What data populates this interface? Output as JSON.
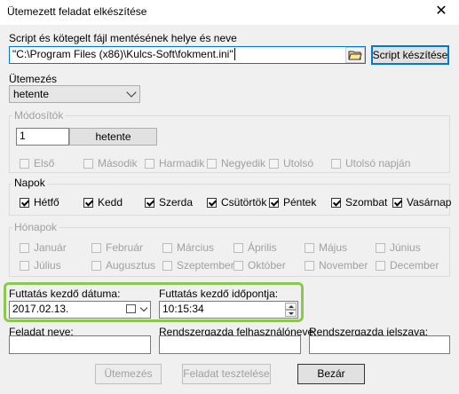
{
  "window": {
    "title": "Ütemezett feladat elkészítése",
    "close_symbol": "✕"
  },
  "script": {
    "label": "Script és kötegelt fájl mentésének helye és neve",
    "path_value": "\"C:\\Program Files (x86)\\Kulcs-Soft\\fokment.ini\"",
    "button": "Script készítése"
  },
  "schedule": {
    "label": "Ütemezés",
    "selected": "hetente"
  },
  "modifiers": {
    "group_title": "Módosítók",
    "number_value": "1",
    "number_button": "hetente",
    "options": [
      {
        "label": "Első",
        "checked": false
      },
      {
        "label": "Második",
        "checked": false
      },
      {
        "label": "Harmadik",
        "checked": false
      },
      {
        "label": "Negyedik",
        "checked": false
      },
      {
        "label": "Utolsó",
        "checked": false
      },
      {
        "label": "Utolsó napján",
        "checked": false
      }
    ]
  },
  "days": {
    "group_title": "Napok",
    "items": [
      {
        "label": "Hétfő",
        "checked": true
      },
      {
        "label": "Kedd",
        "checked": true
      },
      {
        "label": "Szerda",
        "checked": true
      },
      {
        "label": "Csütörtök",
        "checked": true
      },
      {
        "label": "Péntek",
        "checked": true
      },
      {
        "label": "Szombat",
        "checked": true
      },
      {
        "label": "Vasárnap",
        "checked": true
      }
    ]
  },
  "months": {
    "group_title": "Hónapok",
    "items": [
      {
        "label": "Január",
        "checked": false
      },
      {
        "label": "Február",
        "checked": false
      },
      {
        "label": "Március",
        "checked": false
      },
      {
        "label": "Április",
        "checked": false
      },
      {
        "label": "Május",
        "checked": false
      },
      {
        "label": "Június",
        "checked": false
      },
      {
        "label": "Július",
        "checked": false
      },
      {
        "label": "Augusztus",
        "checked": false
      },
      {
        "label": "Szeptember",
        "checked": false
      },
      {
        "label": "Október",
        "checked": false
      },
      {
        "label": "November",
        "checked": false
      },
      {
        "label": "December",
        "checked": false
      }
    ]
  },
  "start": {
    "date_label": "Futtatás kezdő dátuma:",
    "date_value": "2017.02.13.",
    "time_label": "Futtatás kezdő időpontja:",
    "time_value": "10:15:34"
  },
  "credentials": {
    "task_name_label": "Feladat neve:",
    "task_name_value": "",
    "admin_user_label": "Rendszergazda felhasználóneve:",
    "admin_user_value": "",
    "admin_password_label": "Rendszergazda jelszava:",
    "admin_password_value": ""
  },
  "footer": {
    "schedule_button": "Ütemezés",
    "test_button": "Feladat tesztelése",
    "close_button": "Bezár"
  }
}
